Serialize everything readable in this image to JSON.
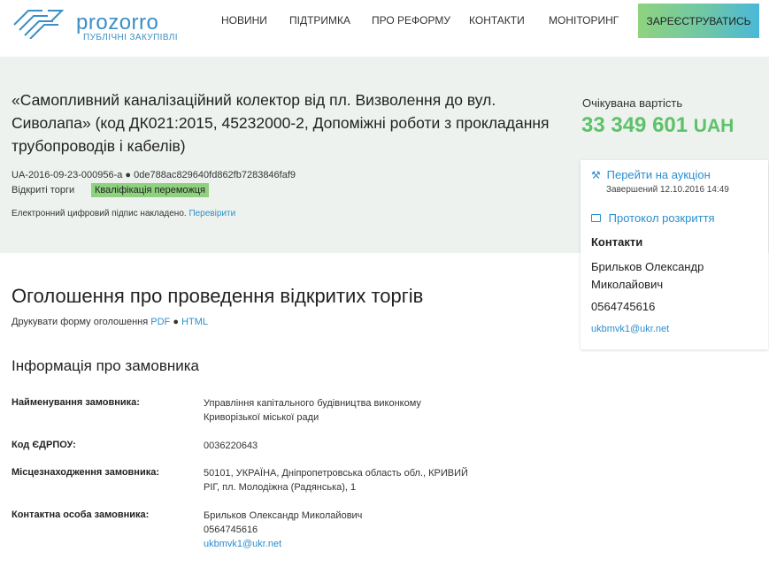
{
  "header": {
    "logo_name": "prozorro",
    "logo_tagline": "ПУБЛІЧНІ ЗАКУПІВЛІ",
    "nav": [
      "НОВИНИ",
      "ПІДТРИМКА",
      "ПРО РЕФОРМУ",
      "КОНТАКТИ",
      "МОНІТОРИНГ"
    ],
    "register_label": "ЗАРЕЄСТРУВАТИСЬ"
  },
  "tender": {
    "title": "«Самопливний каналізаційний колектор від пл. Визволення до вул. Сиволапа» (код ДК021:2015, 45232000-2, Допоміжні роботи з прокладання трубопроводів і кабелів)",
    "id_line": "UA-2016-09-23-000956-a ● 0de788ac829640fd862fb7283846faf9",
    "procedure": "Відкриті торги",
    "status": "Кваліфікація переможця",
    "signature_text": "Електронний цифровий підпис накладено.",
    "signature_link": "Перевірити"
  },
  "price": {
    "label": "Очікувана вартість",
    "amount": "33 349 601",
    "currency": "UAH"
  },
  "side": {
    "auction_link": "Перейти на аукціон",
    "auction_date": "Завершений 12.10.2016 14:49",
    "protocol_link": "Протокол розкриття",
    "contacts_heading": "Контакти",
    "contact_name": "Брильков Олександр Миколайович",
    "contact_phone": "0564745616",
    "contact_email": "ukbmvk1@ukr.net"
  },
  "main": {
    "announce_title": "Оголошення про проведення відкритих торгів",
    "print_text": "Друкувати форму оголошення",
    "print_pdf": "PDF",
    "print_sep": "●",
    "print_html": "HTML",
    "customer_heading": "Інформація про замовника",
    "rows": [
      {
        "label": "Найменування замовника:",
        "value": "Управління капітального будівництва виконкому Криворізької міської ради"
      },
      {
        "label": "Код ЄДРПОУ:",
        "value": "0036220643"
      },
      {
        "label": "Місцезнаходження замовника:",
        "value": "50101, УКРАЇНА, Дніпропетровська область обл., КРИВИЙ РІГ, пл. Молодіжна (Радянська), 1"
      },
      {
        "label": "Контактна особа замовника:",
        "value": "Брильков Олександр Миколайович",
        "phone": "0564745616",
        "email": "ukbmvk1@ukr.net"
      }
    ]
  }
}
